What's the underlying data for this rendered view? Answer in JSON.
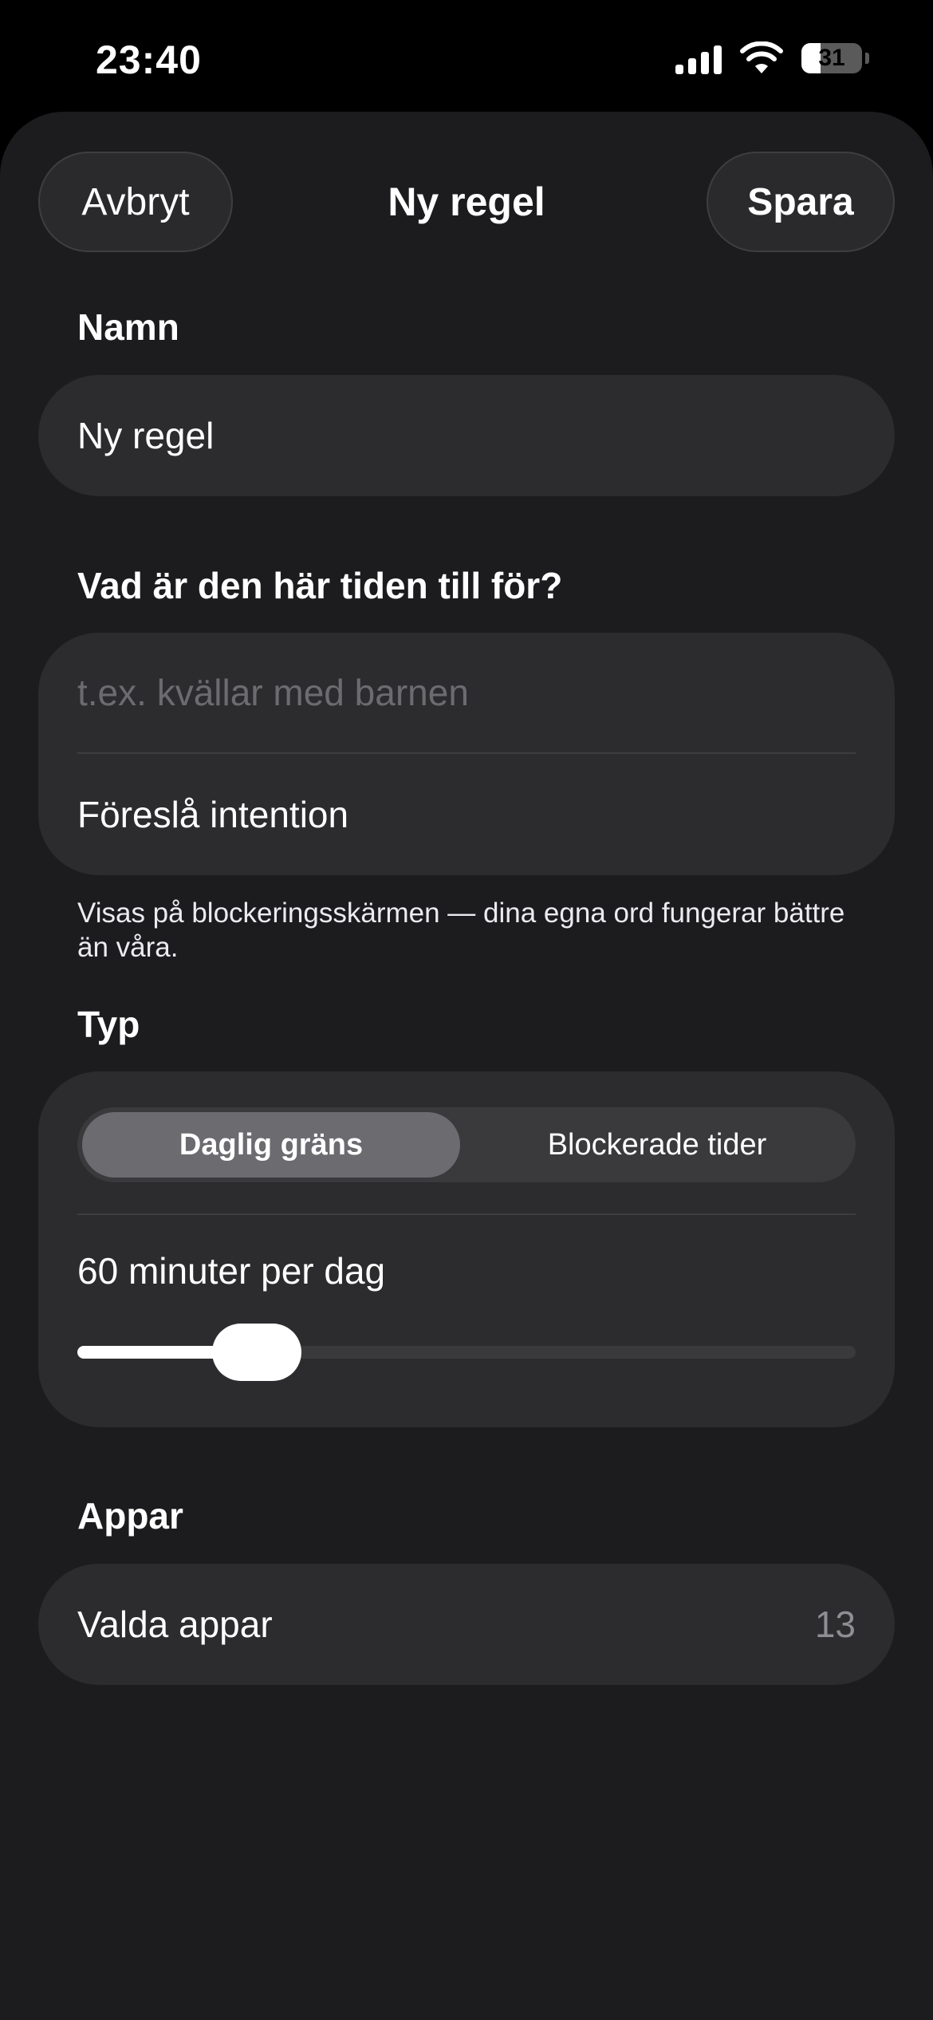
{
  "status_bar": {
    "time": "23:40",
    "battery_level": "31",
    "icons": [
      "signal-icon",
      "wifi-icon",
      "battery-icon"
    ]
  },
  "header": {
    "cancel_label": "Avbryt",
    "title": "Ny regel",
    "save_label": "Spara"
  },
  "name_section": {
    "label": "Namn",
    "value": "Ny regel"
  },
  "intention_section": {
    "label": "Vad är den här tiden till för?",
    "placeholder": "t.ex. kvällar med barnen",
    "suggest_label": "Föreslå intention",
    "footnote": "Visas på blockeringsskärmen — dina egna ord fungerar bättre än våra."
  },
  "type_section": {
    "label": "Typ",
    "segments": [
      "Daglig gräns",
      "Blockerade tider"
    ],
    "selected_segment": "Daglig gräns",
    "limit_text": "60 minuter per dag",
    "slider_fraction": 0.2
  },
  "apps_section": {
    "label": "Appar",
    "row_label": "Valda appar",
    "count": "13"
  },
  "colors": {
    "background": "#1c1c1e",
    "card": "#2c2c2e",
    "segment_selected": "#6b6b70",
    "placeholder": "#6c6c70",
    "secondary_text": "#8e8e93"
  }
}
